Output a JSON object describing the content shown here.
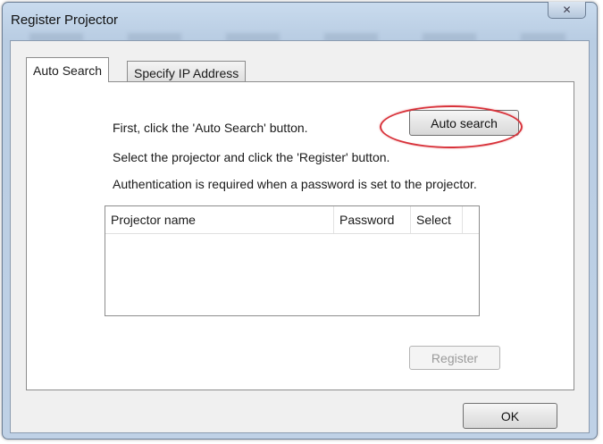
{
  "window": {
    "title": "Register Projector"
  },
  "title_bar": {
    "close_glyph": "✕"
  },
  "tabs": [
    {
      "label": "Auto Search",
      "active": true
    },
    {
      "label": "Specify IP Address",
      "active": false
    }
  ],
  "instructions": {
    "line1": "First, click the 'Auto Search' button.",
    "line2": "Select the projector and click the 'Register' button.",
    "line3": "Authentication is required when a password is set to the projector."
  },
  "buttons": {
    "auto_search": "Auto search",
    "register": "Register",
    "ok": "OK"
  },
  "list": {
    "columns": [
      "Projector name",
      "Password",
      "Select"
    ],
    "rows": []
  },
  "highlight_color": "#d8323a"
}
